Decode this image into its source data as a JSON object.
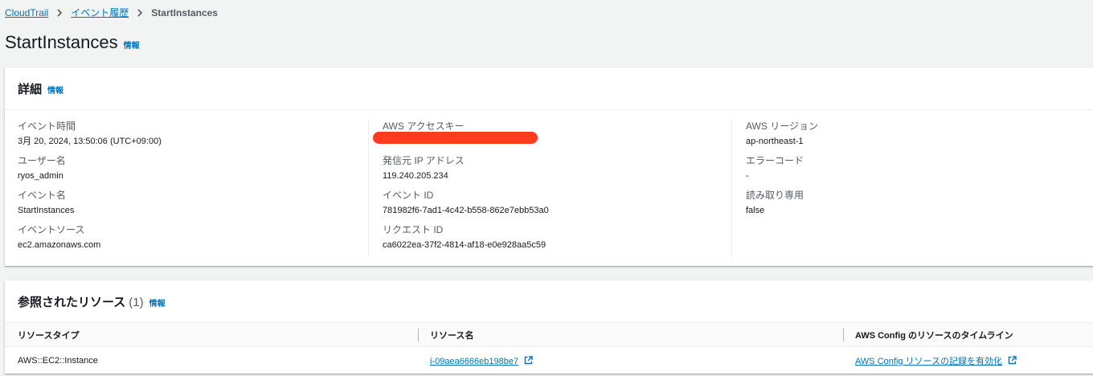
{
  "breadcrumb": {
    "items": [
      "CloudTrail",
      "イベント履歴"
    ],
    "current": "StartInstances"
  },
  "page": {
    "title": "StartInstances",
    "info": "情報"
  },
  "details": {
    "title": "詳細",
    "info": "情報",
    "columns": [
      [
        {
          "label": "イベント時間",
          "value": "3月 20, 2024, 13:50:06 (UTC+09:00)"
        },
        {
          "label": "ユーザー名",
          "value": "ryos_admin"
        },
        {
          "label": "イベント名",
          "value": "StartInstances"
        },
        {
          "label": "イベントソース",
          "value": "ec2.amazonaws.com"
        }
      ],
      [
        {
          "label": "AWS アクセスキー",
          "value": ""
        },
        {
          "label": "発信元 IP アドレス",
          "value": "119.240.205.234"
        },
        {
          "label": "イベント ID",
          "value": "781982f6-7ad1-4c42-b558-862e7ebb53a0"
        },
        {
          "label": "リクエスト ID",
          "value": "ca6022ea-37f2-4814-af18-e0e928aa5c59"
        }
      ],
      [
        {
          "label": "AWS リージョン",
          "value": "ap-northeast-1"
        },
        {
          "label": "エラーコード",
          "value": "-"
        },
        {
          "label": "読み取り専用",
          "value": "false"
        }
      ]
    ]
  },
  "resources": {
    "title": "参照されたリソース",
    "count": "(1)",
    "info": "情報",
    "headers": [
      "リソースタイプ",
      "リソース名",
      "AWS Config のリソースのタイムライン"
    ],
    "rows": [
      {
        "type": "AWS::EC2::Instance",
        "name": "i-09aea6666eb198be7",
        "config_link": "AWS Config リソースの記録を有効化"
      }
    ]
  },
  "colors": {
    "link": "#0073bb",
    "redaction": "#ff3b1f"
  }
}
